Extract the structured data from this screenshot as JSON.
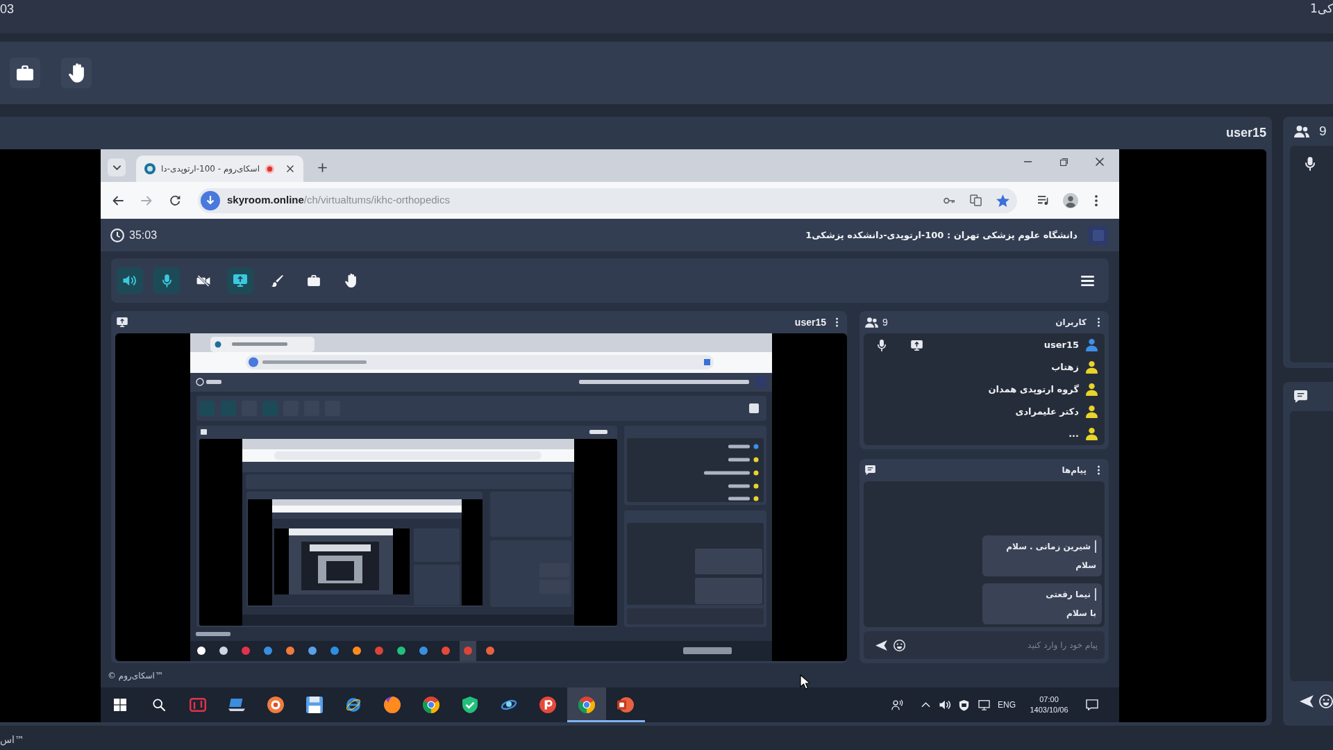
{
  "outer": {
    "timer": "03",
    "title": "کی1",
    "video": {
      "user": "user15"
    },
    "sidebar": {
      "users_count": "9"
    },
    "footer": "اس™"
  },
  "browser": {
    "tab": {
      "title": "اسکای‌روم - 100-ارتوپدی-دا"
    },
    "url": {
      "host": "skyroom.online",
      "path": "/ch/virtualtums/ikhc-orthopedics"
    }
  },
  "page": {
    "timer": "35:03",
    "title": "دانشگاه علوم پزشکی تهران : 100-ارتوپدی-دانشکده پزشکی1",
    "toolbar": [
      {
        "active": true
      },
      {
        "active": true
      },
      {
        "active": false
      },
      {
        "active": true
      },
      {
        "active": false
      },
      {
        "active": false
      },
      {
        "active": false
      }
    ],
    "video": {
      "user": "user15"
    },
    "users": {
      "title": "کاربران",
      "count": "9",
      "items": [
        {
          "name": "user15",
          "current": true
        },
        {
          "name": "زهتاب",
          "current": false
        },
        {
          "name": "گروه ارتوپدی همدان",
          "current": false
        },
        {
          "name": "دکتر علیمرادی",
          "current": false
        },
        {
          "name": "...",
          "current": false
        }
      ]
    },
    "messages": {
      "title": "پیام‌ها",
      "items": [
        {
          "sender": "شیرین زمانی . سلام",
          "text": "سلام"
        },
        {
          "sender": "نیما رفعتی",
          "text": "با سلام"
        }
      ],
      "placeholder": "پیام خود را وارد کنید"
    },
    "footer": "© اسکای‌روم™"
  },
  "taskbar": {
    "apps": [
      {
        "selected": false,
        "running": false
      },
      {
        "selected": false,
        "running": false
      },
      {
        "selected": false,
        "running": false
      },
      {
        "selected": false,
        "running": false
      },
      {
        "selected": false,
        "running": false
      },
      {
        "selected": false,
        "running": false
      },
      {
        "selected": false,
        "running": false
      },
      {
        "selected": false,
        "running": false
      },
      {
        "selected": false,
        "running": false
      },
      {
        "selected": false,
        "running": false
      },
      {
        "selected": true,
        "running": true
      },
      {
        "selected": false,
        "running": true
      }
    ],
    "language": "ENG",
    "time": "07:00",
    "date": "1403/10/06"
  }
}
